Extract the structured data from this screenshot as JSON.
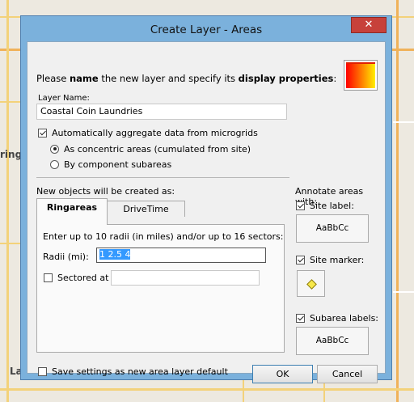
{
  "window": {
    "title": "Create Layer - Areas",
    "close_glyph": "✕"
  },
  "intro": {
    "part1": "Please ",
    "bold1": "name",
    "part2": " the new layer and specify its ",
    "bold2": "display properties",
    "part3": ":"
  },
  "layer_name": {
    "label": "Layer Name:",
    "value": "Coastal Coin Laundries"
  },
  "aggregate": {
    "label": "Automatically aggregate data from microgrids",
    "checked": true,
    "options": [
      {
        "label": "As concentric areas (cumulated from site)",
        "selected": true
      },
      {
        "label": "By component subareas",
        "selected": false
      }
    ]
  },
  "create_as": {
    "label": "New objects will be created as:",
    "tabs": [
      {
        "label": "Ringareas",
        "active": true
      },
      {
        "label": "DriveTime",
        "active": false
      }
    ],
    "instructions": "Enter up to 10 radii (in miles) and/or up to 16 sectors:",
    "radii_label": "Radii (mi):",
    "radii_value": "1 2.5 4",
    "sectored_label": "Sectored at",
    "sectored_checked": false,
    "sectored_value": ""
  },
  "annotate": {
    "heading": "Annotate areas with:",
    "site_label": {
      "label": "Site label:",
      "checked": true,
      "preview": "AaBbCc"
    },
    "site_marker": {
      "label": "Site marker:",
      "checked": true,
      "marker_icon": "diamond-marker-icon",
      "marker_color": "#f7e84a"
    },
    "subarea_labels": {
      "label": "Subarea labels:",
      "checked": true,
      "preview": "AaBbCc"
    }
  },
  "footer": {
    "save_default_label": "Save settings as new area layer default",
    "save_default_checked": false,
    "ok_label": "OK",
    "cancel_label": "Cancel"
  },
  "map_labels": {
    "left_label": "rings",
    "bottom_label": "La"
  },
  "colors": {
    "title_bar": "#7bb1dc",
    "close_button": "#c7413a",
    "swatch_start": "#ff0000",
    "swatch_end": "#ffee00",
    "selection_highlight": "#3399ff"
  }
}
